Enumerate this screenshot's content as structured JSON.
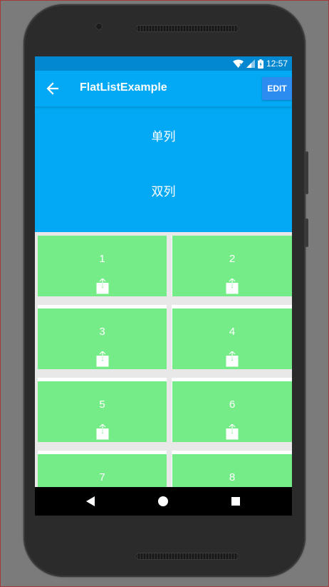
{
  "status_bar": {
    "time": "12:57",
    "icons": [
      "wifi-icon",
      "signal-icon",
      "battery-icon"
    ]
  },
  "toolbar": {
    "title": "FlatListExample",
    "edit_label": "EDIT",
    "back_icon": "arrow-left-icon"
  },
  "header": {
    "options": [
      "单列",
      "双列"
    ]
  },
  "grid": {
    "items": [
      "1",
      "2",
      "3",
      "4",
      "5",
      "6",
      "7",
      "8"
    ],
    "item_icon": "share-icon"
  },
  "nav_bar": {
    "buttons": [
      "back-triangle-icon",
      "home-circle-icon",
      "recents-square-icon"
    ]
  },
  "colors": {
    "status_bar": "#0288d1",
    "primary": "#03a9f4",
    "edit_button": "#2d8cf0",
    "cell_green": "#76ec88",
    "divider": "#e8e8e8"
  }
}
